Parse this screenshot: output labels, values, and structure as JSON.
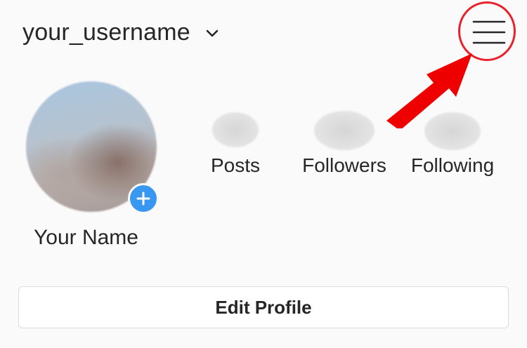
{
  "header": {
    "username": "your_username",
    "account_switcher_icon": "chevron-down-icon",
    "menu_icon": "hamburger-menu-icon"
  },
  "profile": {
    "display_name": "Your Name",
    "add_story_icon": "plus-icon"
  },
  "stats": [
    {
      "label": "Posts"
    },
    {
      "label": "Followers"
    },
    {
      "label": "Following"
    }
  ],
  "actions": {
    "edit_profile_label": "Edit Profile"
  },
  "annotation": {
    "highlight_color": "#e8212c",
    "arrow_color": "#ee0000"
  },
  "colors": {
    "background": "#fafafa",
    "text": "#262626",
    "accent_blue": "#3897f0",
    "border": "#dbdbdb"
  }
}
